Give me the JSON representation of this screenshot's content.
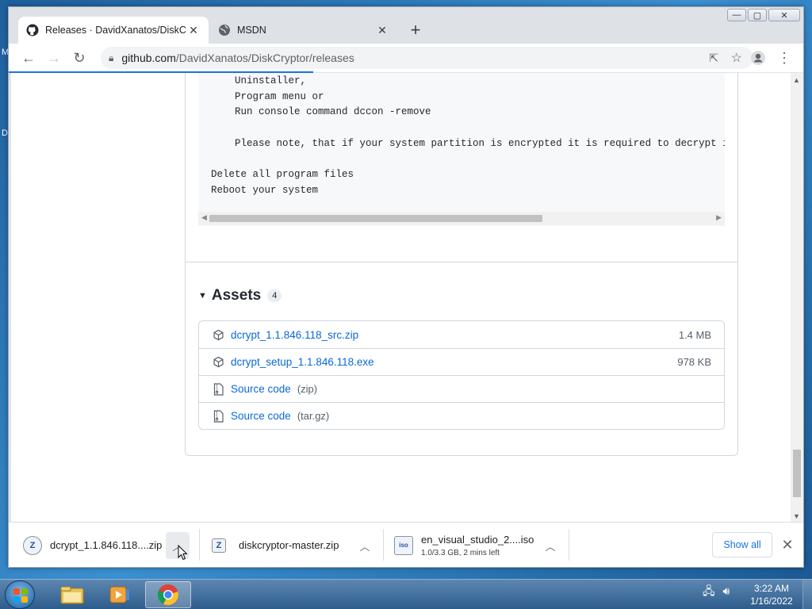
{
  "desktop": {
    "letters": [
      "M",
      "D"
    ]
  },
  "browser": {
    "tabs": [
      {
        "title": "Releases · DavidXanatos/DiskCryptor",
        "favicon": "github-icon",
        "active": true
      },
      {
        "title": "MSDN",
        "favicon": "globe-icon",
        "active": false
      }
    ],
    "new_tab_symbol": "+",
    "url_host": "github.com",
    "url_path": "/DavidXanatos/DiskCryptor/releases",
    "window_buttons": {
      "minimize": "—",
      "maximize": "▢",
      "close": "✕"
    }
  },
  "page": {
    "code_lines": [
      "    Uninstaller,",
      "    Program menu or",
      "    Run console command dccon -remove",
      "",
      "    Please note, that if your system partition is encrypted it is required to decrypt i",
      "",
      "Delete all program files",
      "Reboot your system"
    ],
    "assets_heading": "Assets",
    "assets_count": "4",
    "assets": [
      {
        "name": "dcrypt_1.1.846.118_src.zip",
        "suffix": "",
        "size": "1.4 MB",
        "icon": "package-icon"
      },
      {
        "name": "dcrypt_setup_1.1.846.118.exe",
        "suffix": "",
        "size": "978 KB",
        "icon": "package-icon"
      },
      {
        "name": "Source code",
        "suffix": "(zip)",
        "size": "",
        "icon": "file-zip-icon"
      },
      {
        "name": "Source code",
        "suffix": "(tar.gz)",
        "size": "",
        "icon": "file-zip-icon"
      }
    ]
  },
  "downloads": {
    "items": [
      {
        "name": "dcrypt_1.1.846.118....zip",
        "status": ""
      },
      {
        "name": "diskcryptor-master.zip",
        "status": ""
      },
      {
        "name": "en_visual_studio_2....iso",
        "status": "1.0/3.3 GB, 2 mins left"
      }
    ],
    "show_all_label": "Show all",
    "close_symbol": "✕"
  },
  "taskbar": {
    "time": "3:22 AM",
    "date": "1/16/2022",
    "pinned": [
      "explorer-icon",
      "media-player-icon",
      "chrome-icon"
    ]
  },
  "colors": {
    "link": "#0969da",
    "accent": "#1a73e8"
  }
}
